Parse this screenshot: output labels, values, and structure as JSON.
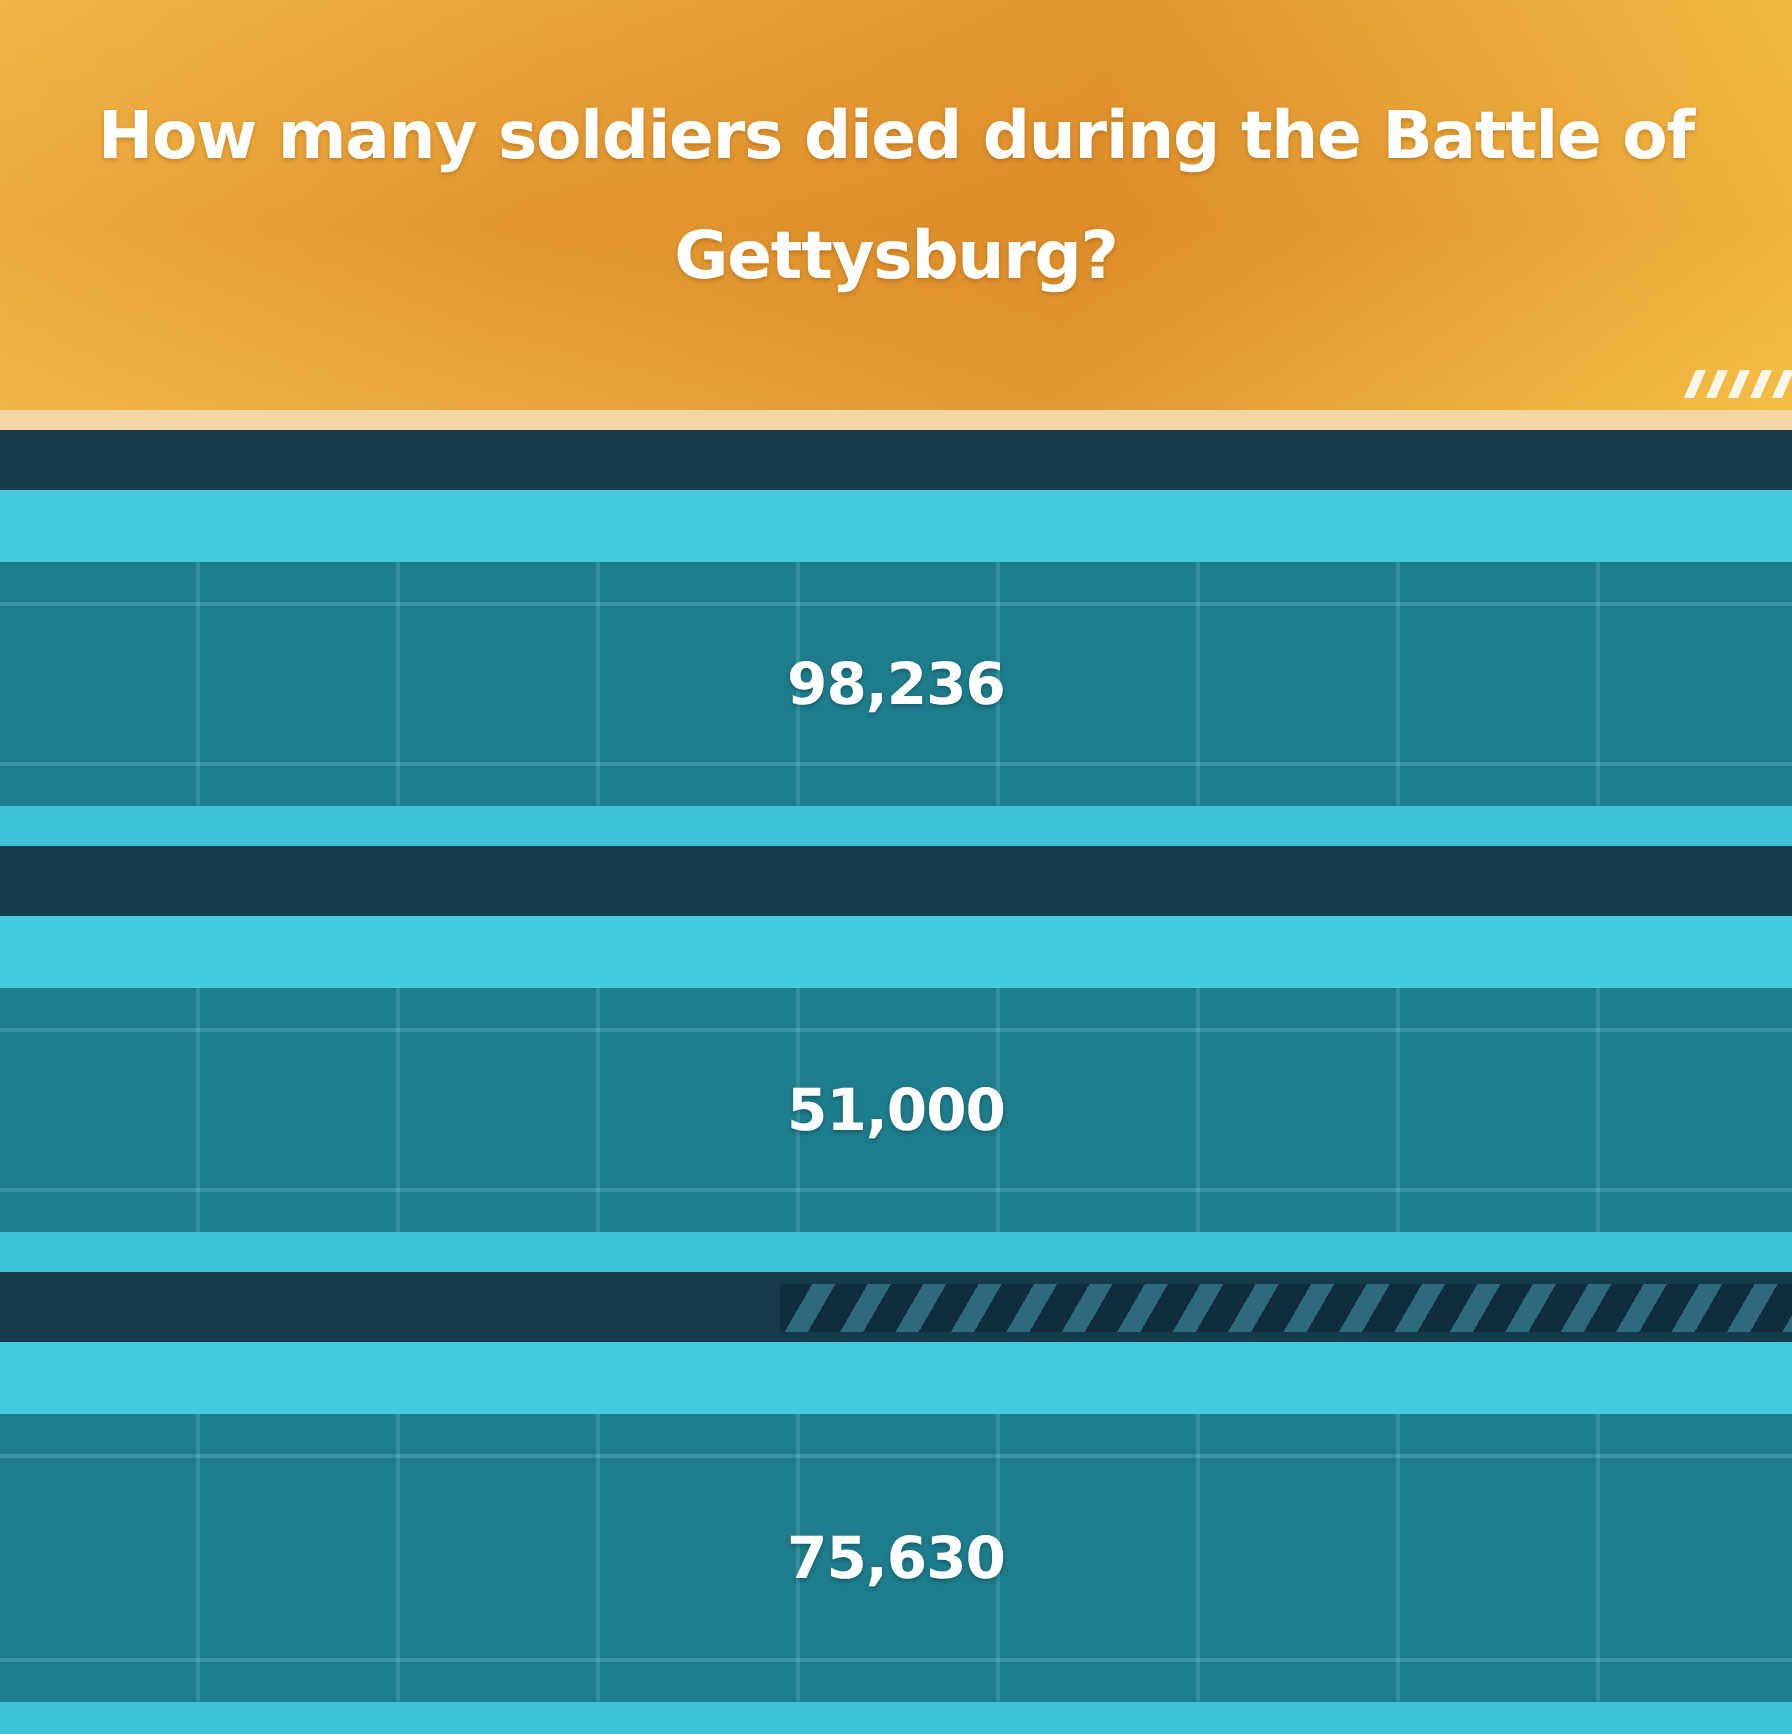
{
  "question": {
    "text": "How many soldiers died during the Battle of Gettysburg?"
  },
  "answers": [
    {
      "label": "98,236"
    },
    {
      "label": "51,000"
    },
    {
      "label": "75,630"
    }
  ]
}
